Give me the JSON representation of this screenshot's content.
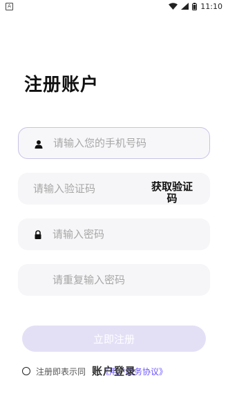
{
  "status_bar": {
    "time": "11:10"
  },
  "page_title": "注册账户",
  "fields": {
    "phone_placeholder": "请输入您的手机号码",
    "code_placeholder": "请输入验证码",
    "password_placeholder": "请输入密码",
    "confirm_password_placeholder": "请重复输入密码"
  },
  "get_code_label": "获取验证码",
  "submit_label": "立即注册",
  "agreement": {
    "prefix": "注册即表示同",
    "link": "《用户服务协议》"
  },
  "login_link": "账户登录"
}
